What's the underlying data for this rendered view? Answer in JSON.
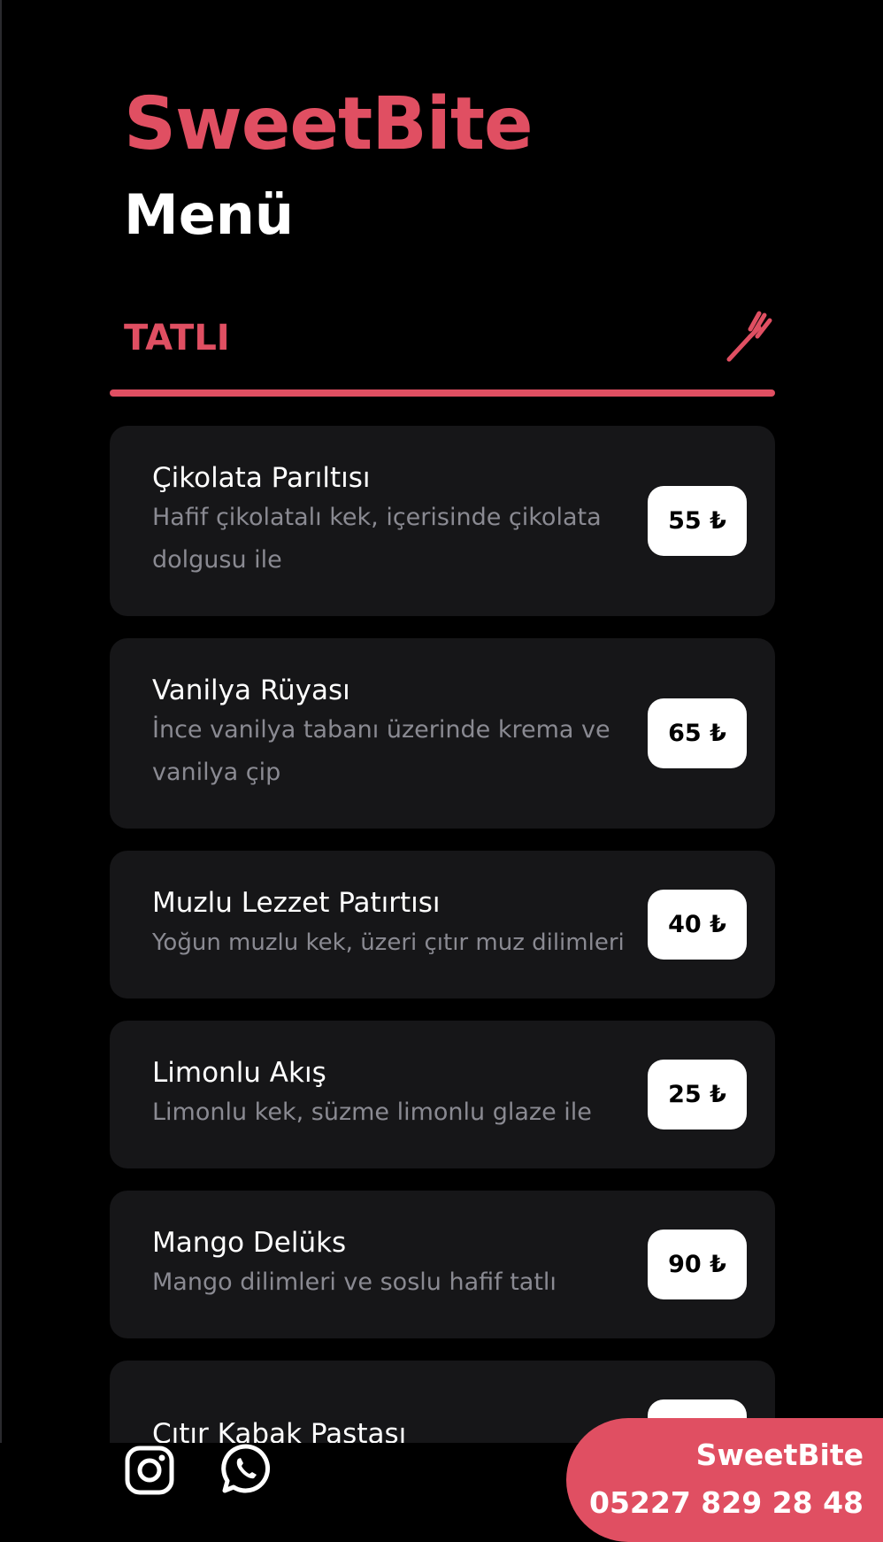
{
  "header": {
    "brand": "SweetBite",
    "subtitle": "Menü"
  },
  "section": {
    "title": "TATLI",
    "icon": "fork-icon"
  },
  "items": [
    {
      "name": "Çikolata Parıltısı",
      "description": "Hafif çikolatalı kek, içerisinde çikolata dolgusu ile",
      "price": "55 ₺"
    },
    {
      "name": "Vanilya Rüyası",
      "description": "İnce vanilya tabanı üzerinde krema ve vanilya çip",
      "price": "65 ₺"
    },
    {
      "name": "Muzlu Lezzet Patırtısı",
      "description": "Yoğun muzlu kek, üzeri çıtır muz dilimleri",
      "price": "40 ₺"
    },
    {
      "name": "Limonlu Akış",
      "description": "Limonlu kek, süzme limonlu glaze ile",
      "price": "25 ₺"
    },
    {
      "name": "Mango Delüks",
      "description": "Mango dilimleri ve soslu hafif tatlı",
      "price": "90 ₺"
    },
    {
      "name": "Çıtır Kabak Pastası",
      "description": "",
      "price": ""
    }
  ],
  "footer": {
    "icons": [
      "instagram-icon",
      "whatsapp-icon"
    ],
    "contact_name": "SweetBite",
    "contact_phone": "05227 829 28 48"
  },
  "colors": {
    "accent": "#e04f62",
    "background": "#000000",
    "card": "#161618"
  }
}
